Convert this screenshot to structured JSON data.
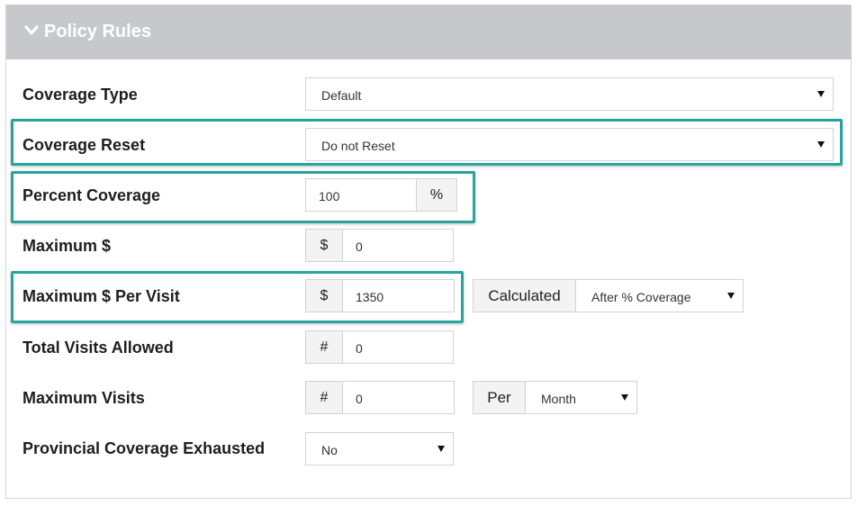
{
  "panel": {
    "title": "Policy Rules",
    "header_bg": "#c6c8cb",
    "highlight_color": "#27a59c"
  },
  "rows": {
    "coverage_type": {
      "label": "Coverage Type",
      "value": "Default"
    },
    "coverage_reset": {
      "label": "Coverage Reset",
      "value": "Do not Reset"
    },
    "percent_coverage": {
      "label": "Percent Coverage",
      "value": "100",
      "addon": "%"
    },
    "maximum_dollar": {
      "label": "Maximum $",
      "addon": "$",
      "value": "0"
    },
    "maximum_dollar_per_visit": {
      "label": "Maximum $ Per Visit",
      "addon": "$",
      "value": "1350",
      "calc_label": "Calculated",
      "calc_value": "After % Coverage"
    },
    "total_visits_allowed": {
      "label": "Total Visits Allowed",
      "addon": "#",
      "value": "0"
    },
    "maximum_visits": {
      "label": "Maximum Visits",
      "addon": "#",
      "value": "0",
      "per_label": "Per",
      "per_value": "Month"
    },
    "provincial_coverage_exhausted": {
      "label": "Provincial Coverage Exhausted",
      "value": "No"
    }
  }
}
